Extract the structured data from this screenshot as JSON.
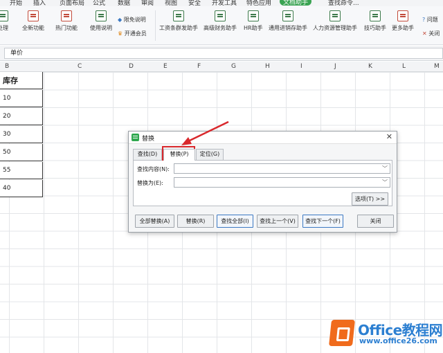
{
  "menubar": {
    "items": [
      "开始",
      "插入",
      "页面布局",
      "公式",
      "数据",
      "审阅",
      "视图",
      "安全",
      "开发工具",
      "特色应用",
      "文档助手",
      "查找命令..."
    ],
    "active": "文档助手"
  },
  "ribbon": {
    "groups": [
      {
        "label": "处理",
        "icon": "process-icon"
      },
      {
        "label": "全新功能",
        "icon": "new-feature-icon"
      },
      {
        "label": "热门功能",
        "icon": "popular-icon"
      },
      {
        "label": "使用说明",
        "icon": "manual-icon"
      },
      {
        "label": "限免说明",
        "icon": "free-limit-icon"
      },
      {
        "label": "开通会员",
        "icon": "crown-icon"
      },
      {
        "label": "工资条群发助手",
        "icon": "payslip-icon"
      },
      {
        "label": "高级财务助手",
        "icon": "finance-icon"
      },
      {
        "label": "HR助手",
        "icon": "hr-icon"
      },
      {
        "label": "通用进销存助手",
        "icon": "inventory-icon"
      },
      {
        "label": "人力资源管理助手",
        "icon": "hr-manage-icon"
      },
      {
        "label": "技巧助手",
        "icon": "tips-icon"
      },
      {
        "label": "更多助手",
        "icon": "more-icon"
      },
      {
        "label": "问题",
        "icon": "question-icon"
      },
      {
        "label": "关闭",
        "icon": "close-box-icon"
      }
    ]
  },
  "formula_bar": {
    "cell_content": "单价"
  },
  "columns": [
    "B",
    "C",
    "D",
    "E",
    "F",
    "G",
    "H",
    "I",
    "J",
    "K",
    "L",
    "M"
  ],
  "sheet": {
    "header": "库存",
    "values": [
      "10",
      "20",
      "30",
      "50",
      "55",
      "40"
    ]
  },
  "dialog": {
    "title": "替换",
    "tabs": [
      "查找(D)",
      "替换(P)",
      "定位(G)"
    ],
    "active_tab": "替换(P)",
    "find_label": "查找内容(N):",
    "find_value": "",
    "replace_label": "替换为(E):",
    "replace_value": "",
    "options_button": "选项(T) >>",
    "buttons": {
      "replace_all": "全部替换(A)",
      "replace": "替换(R)",
      "find_all": "查找全部(I)",
      "find_prev": "查找上一个(V)",
      "find_next": "查找下一个(F)",
      "close": "关闭"
    }
  },
  "watermark": {
    "title": "Office教程网",
    "url": "www.office26.com"
  },
  "colors": {
    "accent": "#3aa352",
    "highlight": "#d9282c",
    "watermark": "#2c7fd1",
    "watermark_logo": "#f06b1c"
  }
}
